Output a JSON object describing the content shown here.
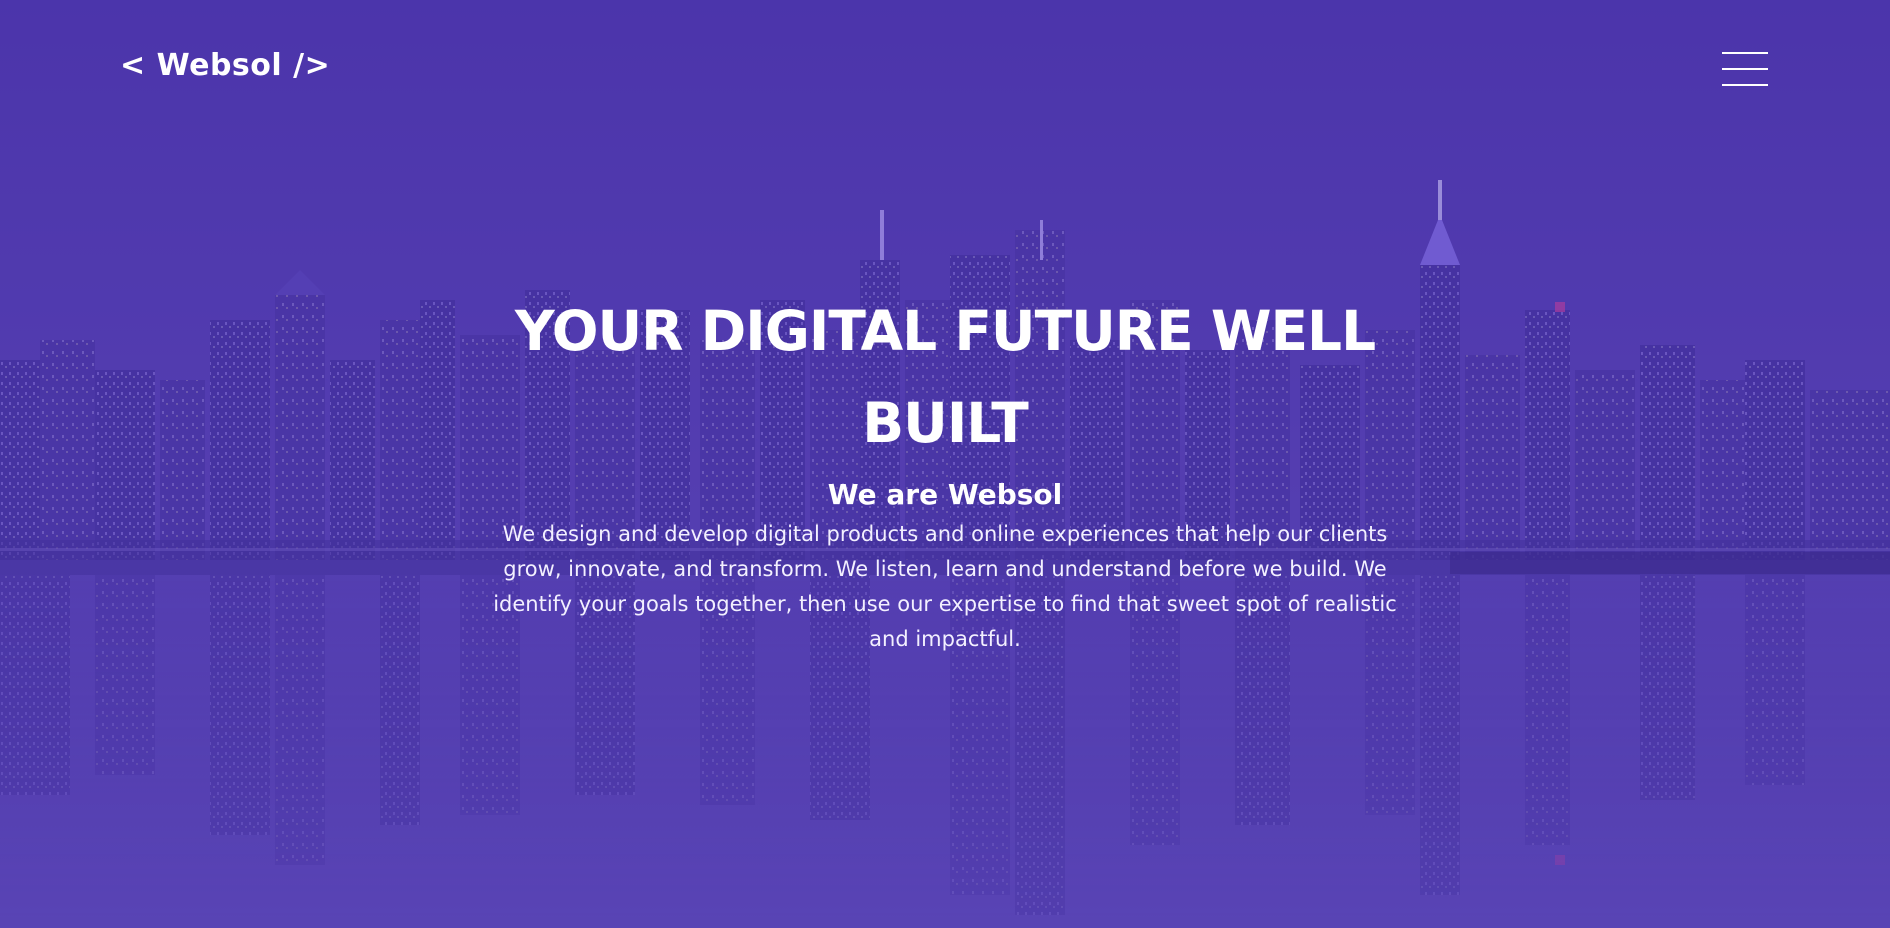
{
  "header": {
    "logo_text": "< Websol />",
    "menu_icon": "hamburger-menu-icon"
  },
  "hero": {
    "headline": "YOUR DIGITAL FUTURE WELL BUILT",
    "subheading": "We are Websol",
    "description": "We design and develop digital products and online experiences that help our clients grow, innovate, and transform. We listen, learn and understand before we build. We identify your goals together, then use our expertise to find that sweet spot of realistic and impactful.",
    "background_image": "city-skyline-reflection-at-night",
    "overlay_color": "#5038af"
  }
}
